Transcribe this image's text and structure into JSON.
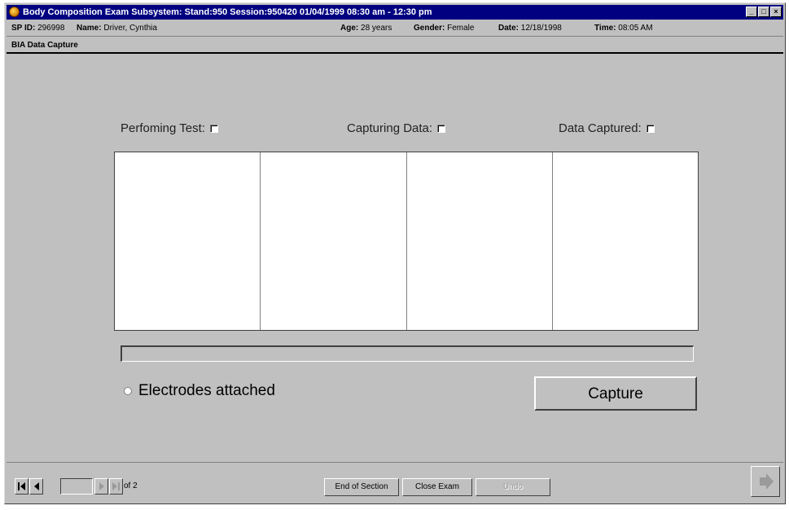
{
  "window": {
    "title": "Body Composition Exam Subsystem: Stand:950 Session:950420 01/04/1999 08:30 am - 12:30 pm",
    "controls": [
      "minimize-icon",
      "maximize-icon",
      "close-icon"
    ]
  },
  "info": {
    "sp_id_label": "SP ID:",
    "sp_id": "296998",
    "name_label": "Name:",
    "name": "Driver, Cynthia",
    "age_label": "Age:",
    "age": "28 years",
    "gender_label": "Gender:",
    "gender": "Female",
    "date_label": "Date:",
    "date": "12/18/1998",
    "time_label": "Time:",
    "time": "08:05 AM"
  },
  "section": {
    "title": "BIA Data Capture"
  },
  "status": {
    "performing": "Perfoming Test:",
    "capturing": "Capturing Data:",
    "captured": "Data Captured:"
  },
  "progress": {
    "value_percent": 0
  },
  "electrodes_label": "Electrodes attached",
  "capture_button": "Capture",
  "nav": {
    "page_value": "",
    "of_pages": "of 2",
    "end_section": "End of Section",
    "close_exam": "Close Exam",
    "third_button": "Undo"
  },
  "colors": {
    "title_bar": "#000080",
    "window_bg": "#c0c0c0"
  }
}
